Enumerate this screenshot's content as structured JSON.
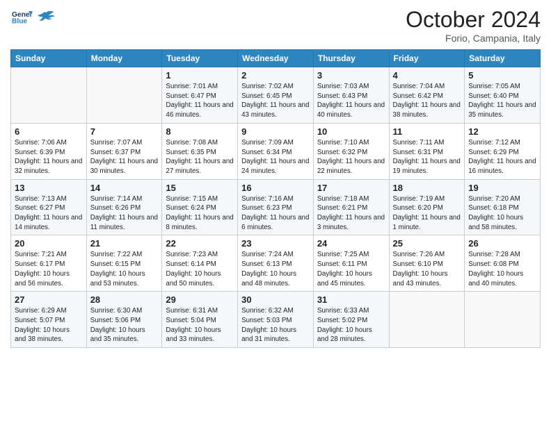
{
  "header": {
    "logo_line1": "General",
    "logo_line2": "Blue",
    "month_title": "October 2024",
    "location": "Forio, Campania, Italy"
  },
  "days_of_week": [
    "Sunday",
    "Monday",
    "Tuesday",
    "Wednesday",
    "Thursday",
    "Friday",
    "Saturday"
  ],
  "weeks": [
    [
      {
        "day": "",
        "info": ""
      },
      {
        "day": "",
        "info": ""
      },
      {
        "day": "1",
        "info": "Sunrise: 7:01 AM\nSunset: 6:47 PM\nDaylight: 11 hours and 46 minutes."
      },
      {
        "day": "2",
        "info": "Sunrise: 7:02 AM\nSunset: 6:45 PM\nDaylight: 11 hours and 43 minutes."
      },
      {
        "day": "3",
        "info": "Sunrise: 7:03 AM\nSunset: 6:43 PM\nDaylight: 11 hours and 40 minutes."
      },
      {
        "day": "4",
        "info": "Sunrise: 7:04 AM\nSunset: 6:42 PM\nDaylight: 11 hours and 38 minutes."
      },
      {
        "day": "5",
        "info": "Sunrise: 7:05 AM\nSunset: 6:40 PM\nDaylight: 11 hours and 35 minutes."
      }
    ],
    [
      {
        "day": "6",
        "info": "Sunrise: 7:06 AM\nSunset: 6:39 PM\nDaylight: 11 hours and 32 minutes."
      },
      {
        "day": "7",
        "info": "Sunrise: 7:07 AM\nSunset: 6:37 PM\nDaylight: 11 hours and 30 minutes."
      },
      {
        "day": "8",
        "info": "Sunrise: 7:08 AM\nSunset: 6:35 PM\nDaylight: 11 hours and 27 minutes."
      },
      {
        "day": "9",
        "info": "Sunrise: 7:09 AM\nSunset: 6:34 PM\nDaylight: 11 hours and 24 minutes."
      },
      {
        "day": "10",
        "info": "Sunrise: 7:10 AM\nSunset: 6:32 PM\nDaylight: 11 hours and 22 minutes."
      },
      {
        "day": "11",
        "info": "Sunrise: 7:11 AM\nSunset: 6:31 PM\nDaylight: 11 hours and 19 minutes."
      },
      {
        "day": "12",
        "info": "Sunrise: 7:12 AM\nSunset: 6:29 PM\nDaylight: 11 hours and 16 minutes."
      }
    ],
    [
      {
        "day": "13",
        "info": "Sunrise: 7:13 AM\nSunset: 6:27 PM\nDaylight: 11 hours and 14 minutes."
      },
      {
        "day": "14",
        "info": "Sunrise: 7:14 AM\nSunset: 6:26 PM\nDaylight: 11 hours and 11 minutes."
      },
      {
        "day": "15",
        "info": "Sunrise: 7:15 AM\nSunset: 6:24 PM\nDaylight: 11 hours and 8 minutes."
      },
      {
        "day": "16",
        "info": "Sunrise: 7:16 AM\nSunset: 6:23 PM\nDaylight: 11 hours and 6 minutes."
      },
      {
        "day": "17",
        "info": "Sunrise: 7:18 AM\nSunset: 6:21 PM\nDaylight: 11 hours and 3 minutes."
      },
      {
        "day": "18",
        "info": "Sunrise: 7:19 AM\nSunset: 6:20 PM\nDaylight: 11 hours and 1 minute."
      },
      {
        "day": "19",
        "info": "Sunrise: 7:20 AM\nSunset: 6:18 PM\nDaylight: 10 hours and 58 minutes."
      }
    ],
    [
      {
        "day": "20",
        "info": "Sunrise: 7:21 AM\nSunset: 6:17 PM\nDaylight: 10 hours and 56 minutes."
      },
      {
        "day": "21",
        "info": "Sunrise: 7:22 AM\nSunset: 6:15 PM\nDaylight: 10 hours and 53 minutes."
      },
      {
        "day": "22",
        "info": "Sunrise: 7:23 AM\nSunset: 6:14 PM\nDaylight: 10 hours and 50 minutes."
      },
      {
        "day": "23",
        "info": "Sunrise: 7:24 AM\nSunset: 6:13 PM\nDaylight: 10 hours and 48 minutes."
      },
      {
        "day": "24",
        "info": "Sunrise: 7:25 AM\nSunset: 6:11 PM\nDaylight: 10 hours and 45 minutes."
      },
      {
        "day": "25",
        "info": "Sunrise: 7:26 AM\nSunset: 6:10 PM\nDaylight: 10 hours and 43 minutes."
      },
      {
        "day": "26",
        "info": "Sunrise: 7:28 AM\nSunset: 6:08 PM\nDaylight: 10 hours and 40 minutes."
      }
    ],
    [
      {
        "day": "27",
        "info": "Sunrise: 6:29 AM\nSunset: 5:07 PM\nDaylight: 10 hours and 38 minutes."
      },
      {
        "day": "28",
        "info": "Sunrise: 6:30 AM\nSunset: 5:06 PM\nDaylight: 10 hours and 35 minutes."
      },
      {
        "day": "29",
        "info": "Sunrise: 6:31 AM\nSunset: 5:04 PM\nDaylight: 10 hours and 33 minutes."
      },
      {
        "day": "30",
        "info": "Sunrise: 6:32 AM\nSunset: 5:03 PM\nDaylight: 10 hours and 31 minutes."
      },
      {
        "day": "31",
        "info": "Sunrise: 6:33 AM\nSunset: 5:02 PM\nDaylight: 10 hours and 28 minutes."
      },
      {
        "day": "",
        "info": ""
      },
      {
        "day": "",
        "info": ""
      }
    ]
  ]
}
